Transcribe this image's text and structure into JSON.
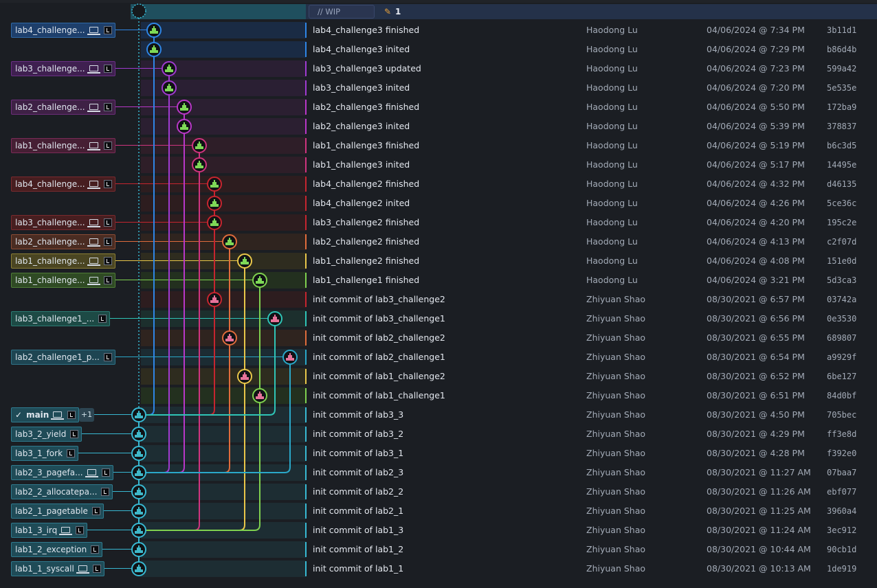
{
  "header": {
    "wip_label": "// WIP",
    "wip_count": "1",
    "pencil_icon": "pencil-icon"
  },
  "colors": {
    "lab4": "#2f86e6",
    "lab3": "#a03bd1",
    "lab2": "#b937c8",
    "lab1": "#d0347f",
    "red": "#c7252f",
    "orange": "#e06c3c",
    "yellow": "#e9c74a",
    "green": "#7fd14f",
    "teal": "#2fc5b7",
    "cyan": "#2aa8c9",
    "main": "#38b9d3"
  },
  "commits": [
    {
      "message": "lab4_challenge3 finished",
      "author": "Haodong Lu",
      "date": "04/06/2024 @ 7:34 PM",
      "sha": "3b11d1",
      "ref": {
        "label": "lab4_challenge...",
        "laptop": true
      }
    },
    {
      "message": "lab4_challenge3 inited",
      "author": "Haodong Lu",
      "date": "04/06/2024 @ 7:29 PM",
      "sha": "b86d4b",
      "ref": null
    },
    {
      "message": "lab3_challenge3 updated",
      "author": "Haodong Lu",
      "date": "04/06/2024 @ 7:23 PM",
      "sha": "599a42",
      "ref": {
        "label": "lab3_challenge...",
        "laptop": true
      }
    },
    {
      "message": "lab3_challenge3 inited",
      "author": "Haodong Lu",
      "date": "04/06/2024 @ 7:20 PM",
      "sha": "5e535e",
      "ref": null
    },
    {
      "message": "lab2_challenge3 finished",
      "author": "Haodong Lu",
      "date": "04/06/2024 @ 5:50 PM",
      "sha": "172ba9",
      "ref": {
        "label": "lab2_challenge...",
        "laptop": true
      }
    },
    {
      "message": "lab2_challenge3 inited",
      "author": "Haodong Lu",
      "date": "04/06/2024 @ 5:39 PM",
      "sha": "378837",
      "ref": null
    },
    {
      "message": "lab1_challenge3 finished",
      "author": "Haodong Lu",
      "date": "04/06/2024 @ 5:19 PM",
      "sha": "b6c3d5",
      "ref": {
        "label": "lab1_challenge...",
        "laptop": true
      }
    },
    {
      "message": "lab1_challenge3 inited",
      "author": "Haodong Lu",
      "date": "04/06/2024 @ 5:17 PM",
      "sha": "14495e",
      "ref": null
    },
    {
      "message": "lab4_challenge2 finished",
      "author": "Haodong Lu",
      "date": "04/06/2024 @ 4:32 PM",
      "sha": "d46135",
      "ref": {
        "label": "lab4_challenge...",
        "laptop": true
      }
    },
    {
      "message": "lab4_challenge2 inited",
      "author": "Haodong Lu",
      "date": "04/06/2024 @ 4:26 PM",
      "sha": "5ce36c",
      "ref": null
    },
    {
      "message": "lab3_challenge2 finished",
      "author": "Haodong Lu",
      "date": "04/06/2024 @ 4:20 PM",
      "sha": "195c2e",
      "ref": {
        "label": "lab3_challenge...",
        "laptop": true
      }
    },
    {
      "message": "lab2_challenge2 finished",
      "author": "Haodong Lu",
      "date": "04/06/2024 @ 4:13 PM",
      "sha": "c2f07d",
      "ref": {
        "label": "lab2_challenge...",
        "laptop": true
      }
    },
    {
      "message": "lab1_challenge2 finished",
      "author": "Haodong Lu",
      "date": "04/06/2024 @ 4:08 PM",
      "sha": "151e0d",
      "ref": {
        "label": "lab1_challenge...",
        "laptop": true
      }
    },
    {
      "message": "lab1_challenge1 finished",
      "author": "Haodong Lu",
      "date": "04/06/2024 @ 3:21 PM",
      "sha": "5d3ca3",
      "ref": {
        "label": "lab1_challenge...",
        "laptop": true
      }
    },
    {
      "message": "init commit of lab3_challenge2",
      "author": "Zhiyuan Shao",
      "date": "08/30/2021 @ 6:57 PM",
      "sha": "03742a",
      "ref": null
    },
    {
      "message": "init commit of lab3_challenge1",
      "author": "Zhiyuan Shao",
      "date": "08/30/2021 @ 6:56 PM",
      "sha": "0e3530",
      "ref": {
        "label": "lab3_challenge1_...",
        "laptop": false
      }
    },
    {
      "message": "init commit of lab2_challenge2",
      "author": "Zhiyuan Shao",
      "date": "08/30/2021 @ 6:55 PM",
      "sha": "689807",
      "ref": null
    },
    {
      "message": "init commit of lab2_challenge1",
      "author": "Zhiyuan Shao",
      "date": "08/30/2021 @ 6:54 PM",
      "sha": "a9929f",
      "ref": {
        "label": "lab2_challenge1_p...",
        "laptop": false
      }
    },
    {
      "message": "init commit of lab1_challenge2",
      "author": "Zhiyuan Shao",
      "date": "08/30/2021 @ 6:52 PM",
      "sha": "6be127",
      "ref": null
    },
    {
      "message": "init commit of lab1_challenge1",
      "author": "Zhiyuan Shao",
      "date": "08/30/2021 @ 6:51 PM",
      "sha": "84d0bf",
      "ref": null
    },
    {
      "message": "init commit of lab3_3",
      "author": "Zhiyuan Shao",
      "date": "08/30/2021 @ 4:50 PM",
      "sha": "705bec",
      "ref": {
        "label": "main",
        "laptop": true,
        "checked": true,
        "extra": "+1"
      }
    },
    {
      "message": "init commit of lab3_2",
      "author": "Zhiyuan Shao",
      "date": "08/30/2021 @ 4:29 PM",
      "sha": "ff3e8d",
      "ref": {
        "label": "lab3_2_yield",
        "laptop": false
      }
    },
    {
      "message": "init commit of lab3_1",
      "author": "Zhiyuan Shao",
      "date": "08/30/2021 @ 4:28 PM",
      "sha": "f392e0",
      "ref": {
        "label": "lab3_1_fork",
        "laptop": false
      }
    },
    {
      "message": "init commit of lab2_3",
      "author": "Zhiyuan Shao",
      "date": "08/30/2021 @ 11:27 AM",
      "sha": "07baa7",
      "ref": {
        "label": "lab2_3_pagefa...",
        "laptop": true
      }
    },
    {
      "message": "init commit of lab2_2",
      "author": "Zhiyuan Shao",
      "date": "08/30/2021 @ 11:26 AM",
      "sha": "ebf077",
      "ref": {
        "label": "lab2_2_allocatepa...",
        "laptop": false
      }
    },
    {
      "message": "init commit of lab2_1",
      "author": "Zhiyuan Shao",
      "date": "08/30/2021 @ 11:25 AM",
      "sha": "3960a4",
      "ref": {
        "label": "lab2_1_pagetable",
        "laptop": false
      }
    },
    {
      "message": "init commit of lab1_3",
      "author": "Zhiyuan Shao",
      "date": "08/30/2021 @ 11:24 AM",
      "sha": "3ec912",
      "ref": {
        "label": "lab1_3_irq",
        "laptop": true
      }
    },
    {
      "message": "init commit of lab1_2",
      "author": "Zhiyuan Shao",
      "date": "08/30/2021 @ 10:44 AM",
      "sha": "90cb1d",
      "ref": {
        "label": "lab1_2_exception",
        "laptop": false
      }
    },
    {
      "message": "init commit of lab1_1",
      "author": "Zhiyuan Shao",
      "date": "08/30/2021 @ 10:13 AM",
      "sha": "1de919",
      "ref": {
        "label": "lab1_1_syscall",
        "laptop": true
      }
    }
  ]
}
